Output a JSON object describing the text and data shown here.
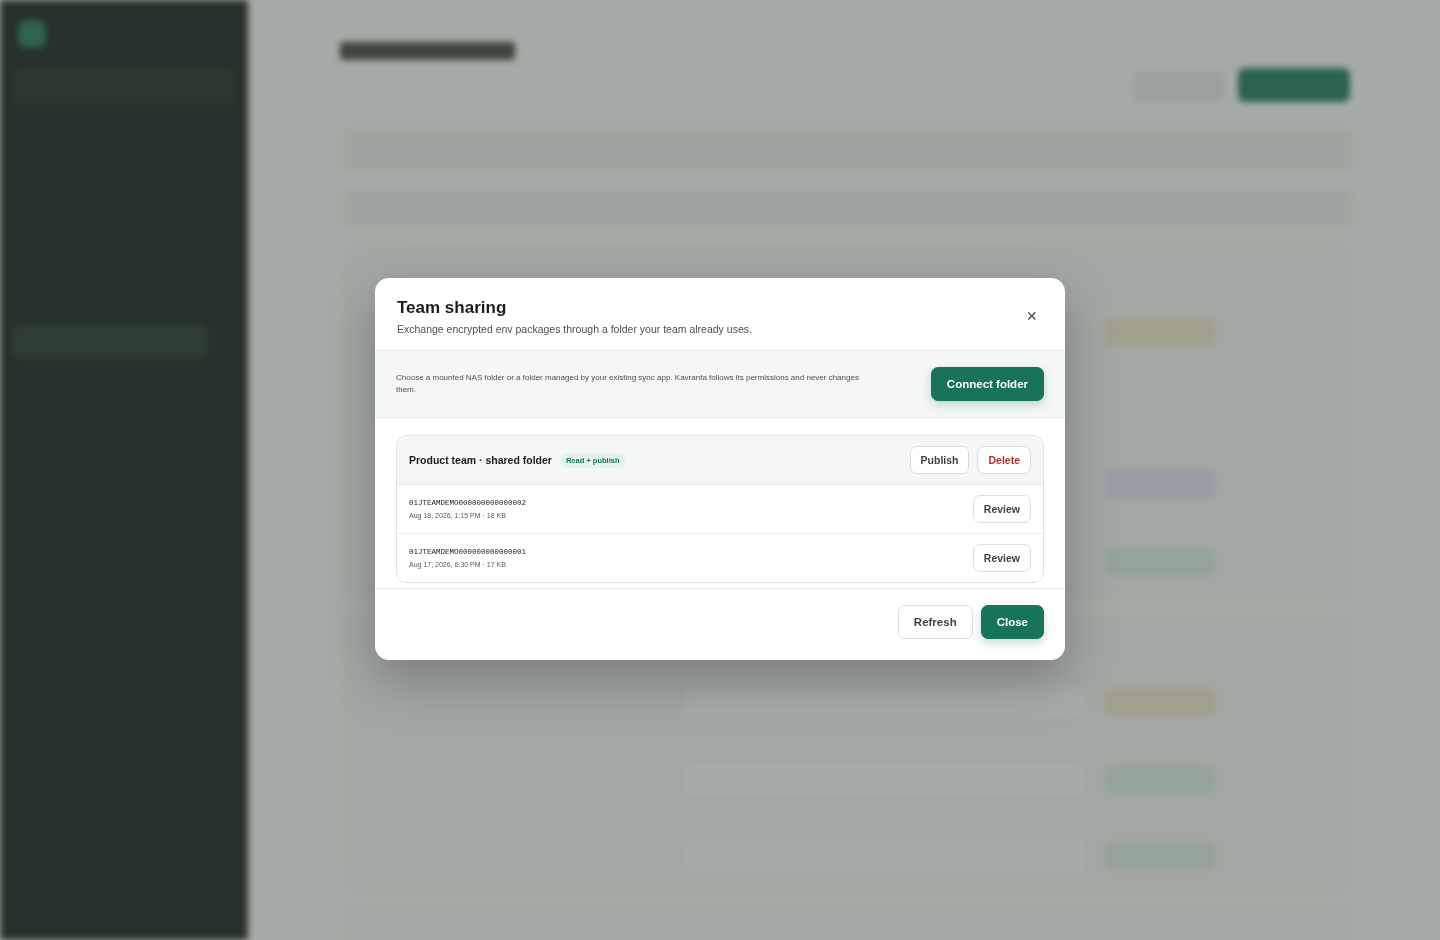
{
  "dialog": {
    "title": "Team sharing",
    "subtitle": "Exchange encrypted env packages through a folder your team already uses.",
    "close": "×",
    "notice": {
      "text": "Choose a mounted NAS folder or a folder managed by your existing sync app. Kavranta follows its permissions and never changes them.",
      "action": "Connect folder"
    },
    "folder": {
      "name": "Product team · shared folder",
      "badge": "Read + publish",
      "actions": [
        {
          "label": "Publish",
          "kind": "neutral"
        },
        {
          "label": "Delete",
          "kind": "danger"
        }
      ],
      "packages": [
        {
          "id": "01JTEAMDEMO000000000000002",
          "meta": "Aug 18, 2026, 1:15 PM · 18 KB",
          "action": "Review"
        },
        {
          "id": "01JTEAMDEMO000000000000001",
          "meta": "Aug 17, 2026, 6:30 PM · 17 KB",
          "action": "Review"
        }
      ]
    },
    "footer": [
      {
        "label": "Refresh",
        "kind": "secondary"
      },
      {
        "label": "Close",
        "kind": "primary"
      }
    ]
  }
}
